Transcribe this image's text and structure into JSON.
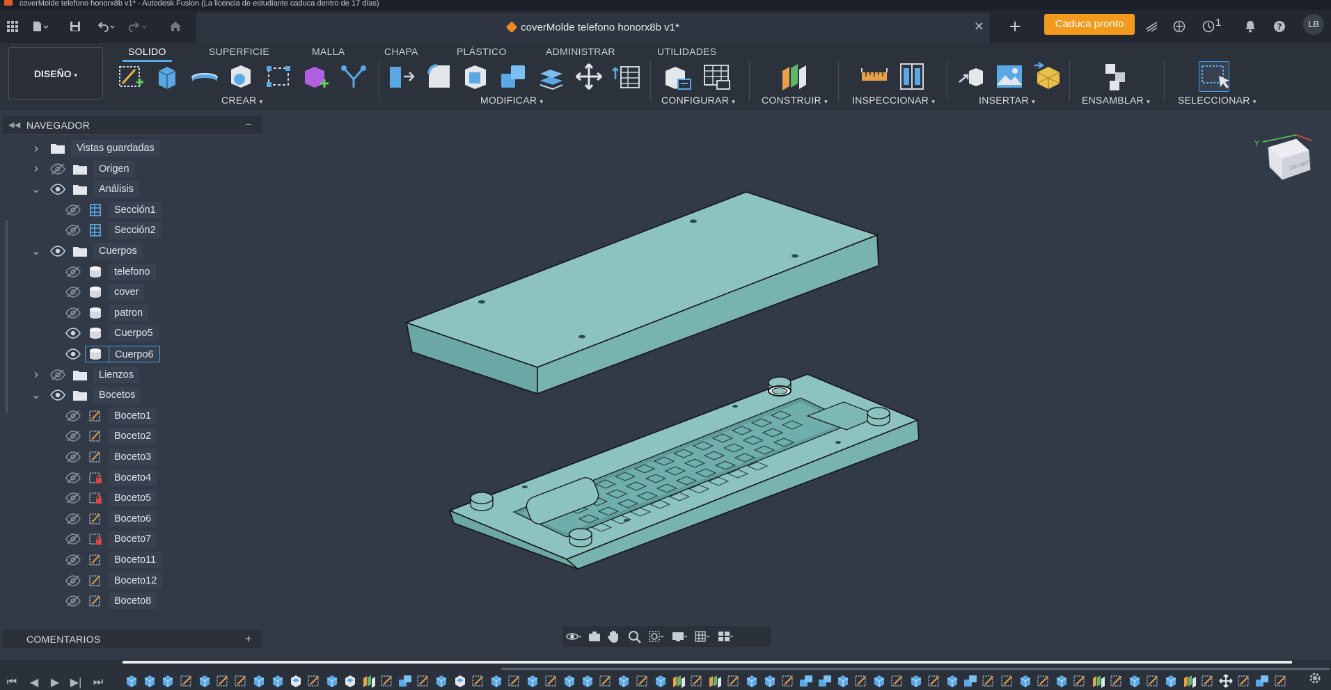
{
  "window": {
    "title": "coverMolde telefono honorx8b v1* - Autodesk Fusion (La licencia de estudiante caduca dentro de 17 días)"
  },
  "document_tab": {
    "title": "coverMolde telefono honorx8b v1*"
  },
  "header_right": {
    "expiry_button": "Caduca pronto",
    "job_count": "1",
    "avatar_initials": "LB"
  },
  "toolbar": {
    "workspace": "DISEÑO",
    "tabs": [
      "SOLIDO",
      "SUPERFICIE",
      "MALLA",
      "CHAPA",
      "PLÁSTICO",
      "ADMINISTRAR",
      "UTILIDADES"
    ],
    "active_tab": "SOLIDO",
    "groups": [
      {
        "label": "CREAR"
      },
      {
        "label": "MODIFICAR"
      },
      {
        "label": "CONFIGURAR"
      },
      {
        "label": "CONSTRUIR"
      },
      {
        "label": "INSPECCIONAR"
      },
      {
        "label": "INSERTAR"
      },
      {
        "label": "ENSAMBLAR"
      },
      {
        "label": "SELECCIONAR"
      }
    ]
  },
  "navigator": {
    "title": "NAVEGADOR",
    "items": [
      {
        "label": "Vistas guardadas",
        "level": 0,
        "expander": "collapsed",
        "visibility": "none",
        "kind": "folder",
        "selected": false
      },
      {
        "label": "Origen",
        "level": 0,
        "expander": "collapsed",
        "visibility": "hidden",
        "kind": "folder",
        "selected": false
      },
      {
        "label": "Análisis",
        "level": 0,
        "expander": "expanded",
        "visibility": "visible",
        "kind": "folder",
        "selected": false
      },
      {
        "label": "Sección1",
        "level": 1,
        "expander": "none",
        "visibility": "hidden",
        "kind": "section",
        "selected": false
      },
      {
        "label": "Sección2",
        "level": 1,
        "expander": "none",
        "visibility": "hidden",
        "kind": "section",
        "selected": false
      },
      {
        "label": "Cuerpos",
        "level": 0,
        "expander": "expanded",
        "visibility": "visible",
        "kind": "folder",
        "selected": false
      },
      {
        "label": "telefono",
        "level": 1,
        "expander": "none",
        "visibility": "hidden",
        "kind": "body",
        "selected": false
      },
      {
        "label": "cover",
        "level": 1,
        "expander": "none",
        "visibility": "hidden",
        "kind": "body",
        "selected": false
      },
      {
        "label": "patron",
        "level": 1,
        "expander": "none",
        "visibility": "hidden",
        "kind": "body",
        "selected": false
      },
      {
        "label": "Cuerpo5",
        "level": 1,
        "expander": "none",
        "visibility": "visible",
        "kind": "body",
        "selected": false
      },
      {
        "label": "Cuerpo6",
        "level": 1,
        "expander": "none",
        "visibility": "visible",
        "kind": "body",
        "selected": true
      },
      {
        "label": "Lienzos",
        "level": 0,
        "expander": "collapsed",
        "visibility": "hidden",
        "kind": "folder",
        "selected": false
      },
      {
        "label": "Bocetos",
        "level": 0,
        "expander": "expanded",
        "visibility": "visible",
        "kind": "folder",
        "selected": false
      },
      {
        "label": "Boceto1",
        "level": 1,
        "expander": "none",
        "visibility": "hidden",
        "kind": "sketch",
        "selected": false
      },
      {
        "label": "Boceto2",
        "level": 1,
        "expander": "none",
        "visibility": "hidden",
        "kind": "sketch",
        "selected": false
      },
      {
        "label": "Boceto3",
        "level": 1,
        "expander": "none",
        "visibility": "hidden",
        "kind": "sketch",
        "selected": false
      },
      {
        "label": "Boceto4",
        "level": 1,
        "expander": "none",
        "visibility": "hidden",
        "kind": "sketch-locked",
        "selected": false
      },
      {
        "label": "Boceto5",
        "level": 1,
        "expander": "none",
        "visibility": "hidden",
        "kind": "sketch-locked",
        "selected": false
      },
      {
        "label": "Boceto6",
        "level": 1,
        "expander": "none",
        "visibility": "hidden",
        "kind": "sketch",
        "selected": false
      },
      {
        "label": "Boceto7",
        "level": 1,
        "expander": "none",
        "visibility": "hidden",
        "kind": "sketch-locked",
        "selected": false
      },
      {
        "label": "Boceto11",
        "level": 1,
        "expander": "none",
        "visibility": "hidden",
        "kind": "sketch",
        "selected": false
      },
      {
        "label": "Boceto12",
        "level": 1,
        "expander": "none",
        "visibility": "hidden",
        "kind": "sketch",
        "selected": false
      },
      {
        "label": "Boceto8",
        "level": 1,
        "expander": "none",
        "visibility": "hidden",
        "kind": "sketch",
        "selected": false
      }
    ]
  },
  "comments": {
    "title": "COMENTARIOS"
  },
  "viewcube": {
    "axis_y": "Y",
    "face_label": "DELANTE"
  },
  "colors": {
    "accent": "#5aa9e6",
    "expiry": "#f39a1c",
    "model": "#8fc3c1"
  }
}
